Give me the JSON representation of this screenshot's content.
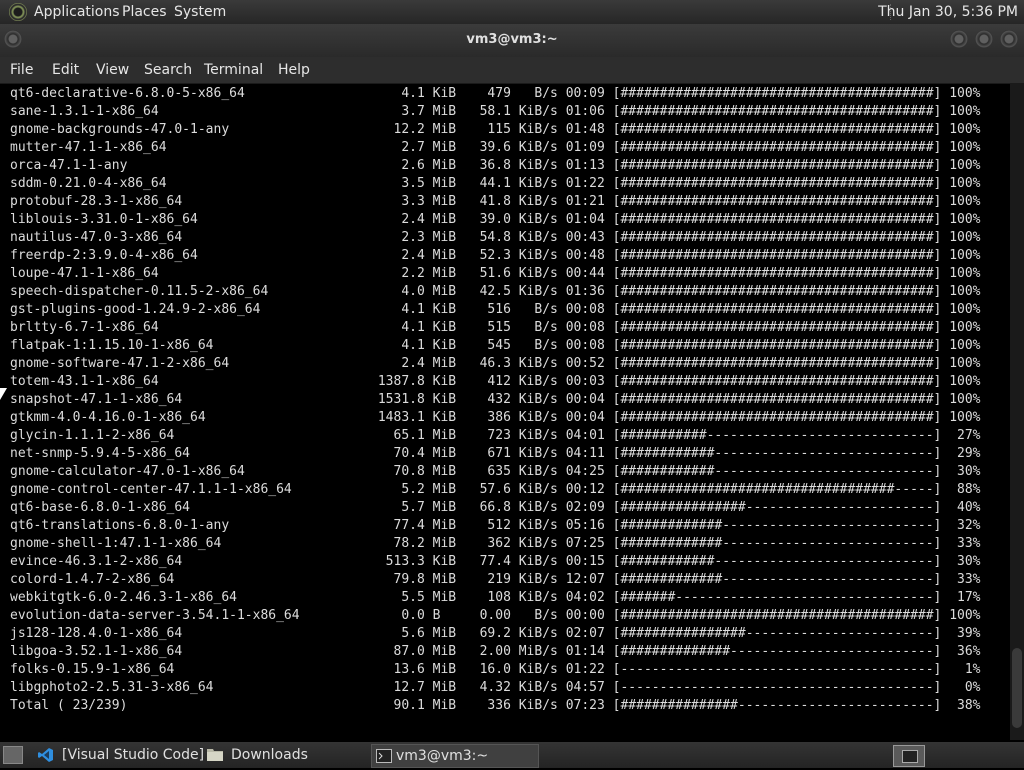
{
  "top_panel": {
    "menus": [
      "Applications",
      "Places",
      "System"
    ],
    "clock": "Thu Jan 30,  5:36 PM"
  },
  "window": {
    "title": "vm3@vm3:~"
  },
  "menubar": [
    "File",
    "Edit",
    "View",
    "Search",
    "Terminal",
    "Help"
  ],
  "terminal": {
    "lines": [
      [
        "qt6-declarative-6.8.0-5-x86_64",
        "4.1",
        "KiB",
        "479",
        "B/s",
        "00:09",
        "[########################################]",
        "100%"
      ],
      [
        "sane-1.3.1-1-x86_64",
        "3.7",
        "MiB",
        "58.1",
        "KiB/s",
        "01:06",
        "[########################################]",
        "100%"
      ],
      [
        "gnome-backgrounds-47.0-1-any",
        "12.2",
        "MiB",
        "115",
        "KiB/s",
        "01:48",
        "[########################################]",
        "100%"
      ],
      [
        "mutter-47.1-1-x86_64",
        "2.7",
        "MiB",
        "39.6",
        "KiB/s",
        "01:09",
        "[########################################]",
        "100%"
      ],
      [
        "orca-47.1-1-any",
        "2.6",
        "MiB",
        "36.8",
        "KiB/s",
        "01:13",
        "[########################################]",
        "100%"
      ],
      [
        "sddm-0.21.0-4-x86_64",
        "3.5",
        "MiB",
        "44.1",
        "KiB/s",
        "01:22",
        "[########################################]",
        "100%"
      ],
      [
        "protobuf-28.3-1-x86_64",
        "3.3",
        "MiB",
        "41.8",
        "KiB/s",
        "01:21",
        "[########################################]",
        "100%"
      ],
      [
        "liblouis-3.31.0-1-x86_64",
        "2.4",
        "MiB",
        "39.0",
        "KiB/s",
        "01:04",
        "[########################################]",
        "100%"
      ],
      [
        "nautilus-47.0-3-x86_64",
        "2.3",
        "MiB",
        "54.8",
        "KiB/s",
        "00:43",
        "[########################################]",
        "100%"
      ],
      [
        "freerdp-2:3.9.0-4-x86_64",
        "2.4",
        "MiB",
        "52.3",
        "KiB/s",
        "00:48",
        "[########################################]",
        "100%"
      ],
      [
        "loupe-47.1-1-x86_64",
        "2.2",
        "MiB",
        "51.6",
        "KiB/s",
        "00:44",
        "[########################################]",
        "100%"
      ],
      [
        "speech-dispatcher-0.11.5-2-x86_64",
        "4.0",
        "MiB",
        "42.5",
        "KiB/s",
        "01:36",
        "[########################################]",
        "100%"
      ],
      [
        "gst-plugins-good-1.24.9-2-x86_64",
        "4.1",
        "KiB",
        "516",
        "B/s",
        "00:08",
        "[########################################]",
        "100%"
      ],
      [
        "brltty-6.7-1-x86_64",
        "4.1",
        "KiB",
        "515",
        "B/s",
        "00:08",
        "[########################################]",
        "100%"
      ],
      [
        "flatpak-1:1.15.10-1-x86_64",
        "4.1",
        "KiB",
        "545",
        "B/s",
        "00:08",
        "[########################################]",
        "100%"
      ],
      [
        "gnome-software-47.1-2-x86_64",
        "2.4",
        "MiB",
        "46.3",
        "KiB/s",
        "00:52",
        "[########################################]",
        "100%"
      ],
      [
        "totem-43.1-1-x86_64",
        "1387.8",
        "KiB",
        "412",
        "KiB/s",
        "00:03",
        "[########################################]",
        "100%"
      ],
      [
        "snapshot-47.1-1-x86_64",
        "1531.8",
        "KiB",
        "432",
        "KiB/s",
        "00:04",
        "[########################################]",
        "100%"
      ],
      [
        "gtkmm-4.0-4.16.0-1-x86_64",
        "1483.1",
        "KiB",
        "386",
        "KiB/s",
        "00:04",
        "[########################################]",
        "100%"
      ],
      [
        "glycin-1.1.1-2-x86_64",
        "65.1",
        "MiB",
        "723",
        "KiB/s",
        "04:01",
        "[###########-----------------------------]",
        "27%"
      ],
      [
        "net-snmp-5.9.4-5-x86_64",
        "70.4",
        "MiB",
        "671",
        "KiB/s",
        "04:11",
        "[############----------------------------]",
        "29%"
      ],
      [
        "gnome-calculator-47.0-1-x86_64",
        "70.8",
        "MiB",
        "635",
        "KiB/s",
        "04:25",
        "[############----------------------------]",
        "30%"
      ],
      [
        "gnome-control-center-47.1.1-1-x86_64",
        "5.2",
        "MiB",
        "57.6",
        "KiB/s",
        "00:12",
        "[###################################-----]",
        "88%"
      ],
      [
        "qt6-base-6.8.0-1-x86_64",
        "5.7",
        "MiB",
        "66.8",
        "KiB/s",
        "02:09",
        "[################------------------------]",
        "40%"
      ],
      [
        "qt6-translations-6.8.0-1-any",
        "77.4",
        "MiB",
        "512",
        "KiB/s",
        "05:16",
        "[#############---------------------------]",
        "32%"
      ],
      [
        "gnome-shell-1:47.1-1-x86_64",
        "78.2",
        "MiB",
        "362",
        "KiB/s",
        "07:25",
        "[#############---------------------------]",
        "33%"
      ],
      [
        "evince-46.3.1-2-x86_64",
        "513.3",
        "KiB",
        "77.4",
        "KiB/s",
        "00:15",
        "[############----------------------------]",
        "30%"
      ],
      [
        "colord-1.4.7-2-x86_64",
        "79.8",
        "MiB",
        "219",
        "KiB/s",
        "12:07",
        "[#############---------------------------]",
        "33%"
      ],
      [
        "webkitgtk-6.0-2.46.3-1-x86_64",
        "5.5",
        "MiB",
        "108",
        "KiB/s",
        "04:02",
        "[#######---------------------------------]",
        "17%"
      ],
      [
        "evolution-data-server-3.54.1-1-x86_64",
        "0.0",
        "B",
        "0.00",
        "B/s",
        "00:00",
        "[########################################]",
        "100%"
      ],
      [
        "js128-128.4.0-1-x86_64",
        "5.6",
        "MiB",
        "69.2",
        "KiB/s",
        "02:07",
        "[################------------------------]",
        "39%"
      ],
      [
        "libgoa-3.52.1-1-x86_64",
        "87.0",
        "MiB",
        "2.00",
        "MiB/s",
        "01:14",
        "[##############--------------------------]",
        "36%"
      ],
      [
        "folks-0.15.9-1-x86_64",
        "13.6",
        "MiB",
        "16.0",
        "KiB/s",
        "01:22",
        "[----------------------------------------]",
        "1%"
      ],
      [
        "libgphoto2-2.5.31-3-x86_64",
        "12.7",
        "MiB",
        "4.32",
        "KiB/s",
        "04:57",
        "[----------------------------------------]",
        "0%"
      ],
      [
        "Total ( 23/239)",
        "90.1",
        "MiB",
        "336",
        "KiB/s",
        "07:23",
        "[###############-------------------------]",
        "38%"
      ]
    ]
  },
  "taskbar": {
    "tasks": [
      "[Visual Studio Code]",
      "Downloads",
      "vm3@vm3:~"
    ]
  }
}
